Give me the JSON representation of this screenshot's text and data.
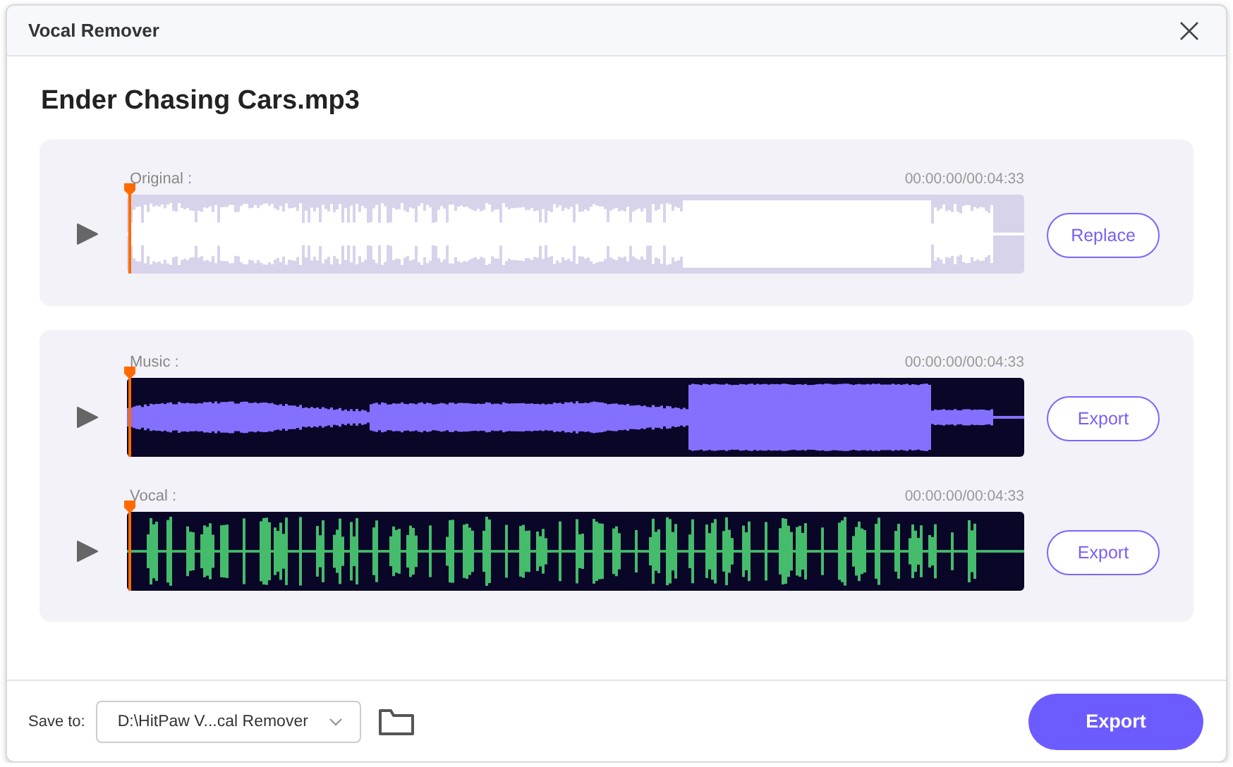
{
  "window": {
    "title": "Vocal Remover"
  },
  "file_name": "Ender Chasing Cars.mp3",
  "cards": [
    {
      "tracks": [
        {
          "kind": "original",
          "label": "Original :",
          "time": "00:00:00/00:04:33",
          "button": "Replace"
        }
      ]
    },
    {
      "tracks": [
        {
          "kind": "music",
          "label": "Music :",
          "time": "00:00:00/00:04:33",
          "button": "Export"
        },
        {
          "kind": "vocal",
          "label": "Vocal :",
          "time": "00:00:00/00:04:33",
          "button": "Export"
        }
      ]
    }
  ],
  "footer": {
    "save_label": "Save to:",
    "path": "D:\\HitPaw V...cal Remover",
    "export_button": "Export"
  }
}
